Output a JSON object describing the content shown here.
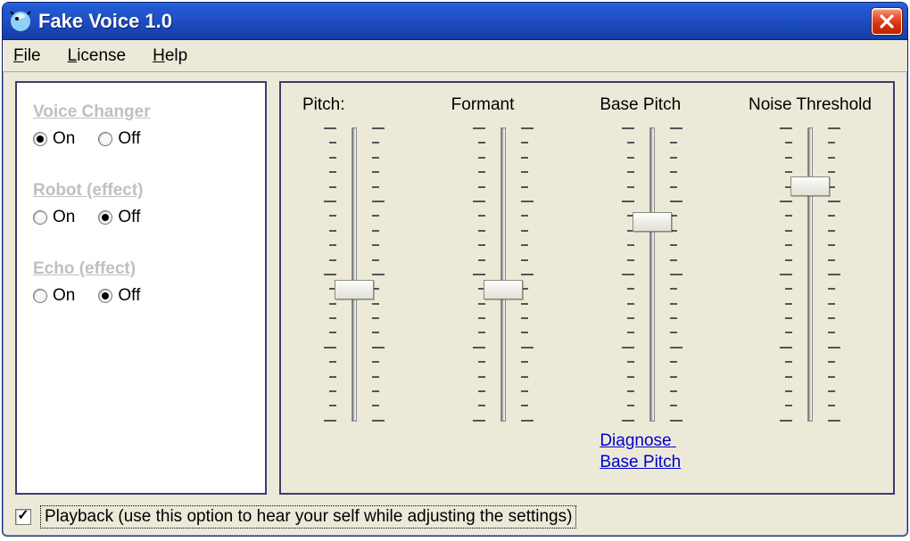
{
  "window": {
    "title": "Fake Voice 1.0"
  },
  "menu": {
    "file": "File",
    "license": "License",
    "help": "Help"
  },
  "effects": {
    "voice_changer": {
      "title": "Voice Changer",
      "on": "On",
      "off": "Off",
      "value": "on"
    },
    "robot": {
      "title": "Robot (effect)",
      "on": "On",
      "off": "Off",
      "value": "off"
    },
    "echo": {
      "title": "Echo (effect)",
      "on": "On",
      "off": "Off",
      "value": "off"
    }
  },
  "sliders": {
    "pitch": {
      "label": "Pitch:",
      "value": 45,
      "min": 0,
      "max": 100
    },
    "formant": {
      "label": "Formant",
      "value": 45,
      "min": 0,
      "max": 100
    },
    "base_pitch": {
      "label": "Base Pitch",
      "value": 68,
      "min": 0,
      "max": 100
    },
    "noise_threshold": {
      "label": "Noise Threshold",
      "value": 80,
      "min": 0,
      "max": 100
    }
  },
  "diagnose": {
    "line1": "Diagnose",
    "line2": "Base Pitch"
  },
  "playback": {
    "checked": true,
    "label": "Playback (use this option to hear your self while adjusting the settings)"
  }
}
